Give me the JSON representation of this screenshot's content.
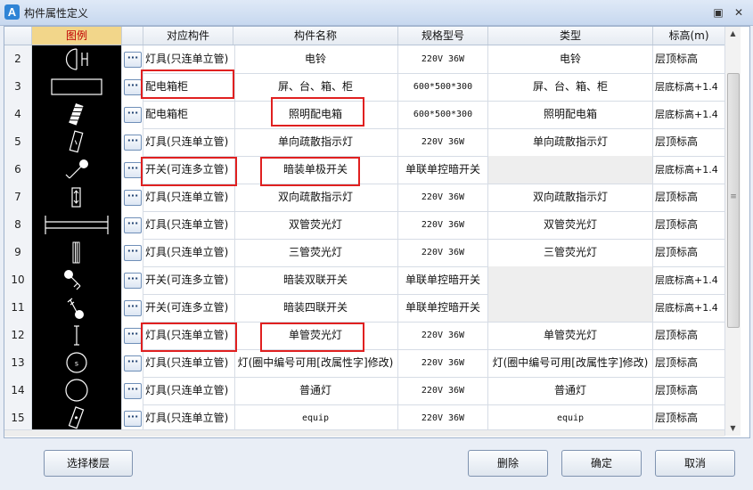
{
  "window": {
    "title": "构件属性定义",
    "app_icon_letter": "A",
    "restore_glyph": "▣",
    "close_glyph": "✕"
  },
  "table": {
    "headers": [
      "",
      "图例",
      "",
      "对应构件",
      "构件名称",
      "规格型号",
      "类型",
      "标高(m)"
    ],
    "more_glyph": "···",
    "rows": [
      {
        "num": "2",
        "symbol": "sym-half-circle-h",
        "component": "灯具(只连单立管)",
        "name": "电铃",
        "spec": "220V 36W",
        "type": "电铃",
        "elevation": "层顶标高"
      },
      {
        "num": "3",
        "symbol": "sym-rectangle",
        "component": "配电箱柜",
        "name": "屏、台、箱、柜",
        "spec": "600*500*300",
        "type": "屏、台、箱、柜",
        "elevation": "层底标高+1.4"
      },
      {
        "num": "4",
        "symbol": "sym-hatched-box",
        "component": "配电箱柜",
        "name": "照明配电箱",
        "spec": "600*500*300",
        "type": "照明配电箱",
        "elevation": "层底标高+1.4"
      },
      {
        "num": "5",
        "symbol": "sym-slanted-box",
        "component": "灯具(只连单立管)",
        "name": "单向疏散指示灯",
        "spec": "220V 36W",
        "type": "单向疏散指示灯",
        "elevation": "层顶标高"
      },
      {
        "num": "6",
        "symbol": "sym-switch-single",
        "component": "开关(可连多立管)",
        "name": "暗装单极开关",
        "spec": "单联单控暗开关",
        "type": "",
        "elevation": "层底标高+1.4"
      },
      {
        "num": "7",
        "symbol": "sym-box-arrows",
        "component": "灯具(只连单立管)",
        "name": "双向疏散指示灯",
        "spec": "220V 36W",
        "type": "双向疏散指示灯",
        "elevation": "层顶标高"
      },
      {
        "num": "8",
        "symbol": "sym-double-tube",
        "component": "灯具(只连单立管)",
        "name": "双管荧光灯",
        "spec": "220V 36W",
        "type": "双管荧光灯",
        "elevation": "层顶标高"
      },
      {
        "num": "9",
        "symbol": "sym-triple-tube",
        "component": "灯具(只连单立管)",
        "name": "三管荧光灯",
        "spec": "220V 36W",
        "type": "三管荧光灯",
        "elevation": "层顶标高"
      },
      {
        "num": "10",
        "symbol": "sym-switch-double",
        "component": "开关(可连多立管)",
        "name": "暗装双联开关",
        "spec": "单联单控暗开关",
        "type": "",
        "elevation": "层底标高+1.4"
      },
      {
        "num": "11",
        "symbol": "sym-switch-quad",
        "component": "开关(可连多立管)",
        "name": "暗装四联开关",
        "spec": "单联单控暗开关",
        "type": "",
        "elevation": "层底标高+1.4"
      },
      {
        "num": "12",
        "symbol": "sym-single-tube",
        "component": "灯具(只连单立管)",
        "name": "单管荧光灯",
        "spec": "220V 36W",
        "type": "单管荧光灯",
        "elevation": "层顶标高"
      },
      {
        "num": "13",
        "symbol": "sym-circle-s",
        "component": "灯具(只连单立管)",
        "name": "灯(圈中编号可用[改属性字]修改)",
        "spec": "220V 36W",
        "type": "灯(圈中编号可用[改属性字]修改)",
        "elevation": "层顶标高"
      },
      {
        "num": "14",
        "symbol": "sym-circle",
        "component": "灯具(只连单立管)",
        "name": "普通灯",
        "spec": "220V 36W",
        "type": "普通灯",
        "elevation": "层顶标高"
      },
      {
        "num": "15",
        "symbol": "sym-slanted-box-dot",
        "component": "灯具(只连单立管)",
        "name": "equip",
        "spec": "220V 36W",
        "type": "equip",
        "elevation": "层顶标高"
      }
    ]
  },
  "scrollbar": {
    "up_glyph": "▲",
    "down_glyph": "▼",
    "grip_glyph": "≡"
  },
  "buttons": {
    "select_floor": "选择楼层",
    "delete": "删除",
    "confirm": "确定",
    "cancel": "取消"
  },
  "colors": {
    "accent_header": "#f2d68a",
    "legend_header_text": "#c00000",
    "highlight_box": "#e02020"
  }
}
